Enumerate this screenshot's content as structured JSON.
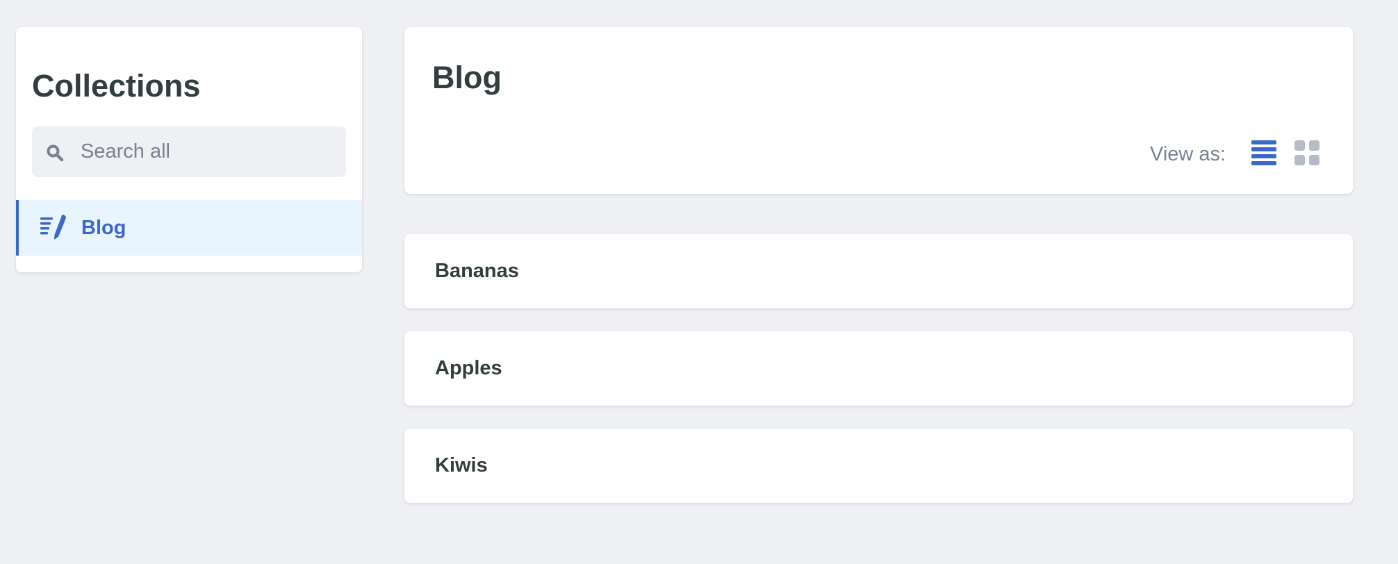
{
  "sidebar": {
    "title": "Collections",
    "search": {
      "placeholder": "Search all",
      "value": ""
    },
    "items": [
      {
        "label": "Blog",
        "icon": "write-icon",
        "active": true
      }
    ]
  },
  "header": {
    "title": "Blog",
    "view_as_label": "View as:",
    "view_modes": [
      {
        "name": "list",
        "icon": "list-view-icon",
        "active": true
      },
      {
        "name": "grid",
        "icon": "grid-view-icon",
        "active": false
      }
    ]
  },
  "entries": [
    {
      "title": "Bananas"
    },
    {
      "title": "Apples"
    },
    {
      "title": "Kiwis"
    }
  ],
  "colors": {
    "background": "#eff0f4",
    "accent": "#3a69c7",
    "active_item_bg": "#e8f5fe",
    "text": "#313d3e",
    "muted_text": "#798291",
    "inactive_icon": "#b6bcc6"
  }
}
